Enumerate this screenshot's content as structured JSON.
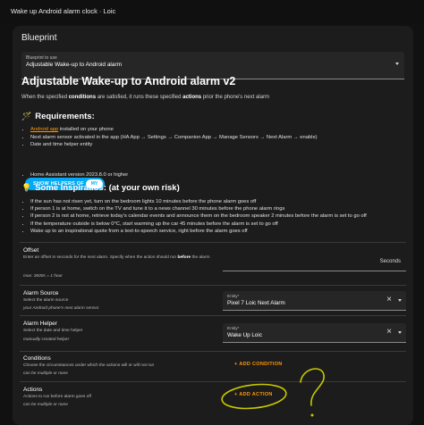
{
  "window": {
    "title": "Wake up Android alarm clock · Loic"
  },
  "card": {
    "title": "Blueprint"
  },
  "blueprint_select": {
    "label": "Blueprint to use",
    "value": "Adjustable Wake-up to Android alarm"
  },
  "blueprint": {
    "title": "Adjustable Wake-up to Android alarm v2",
    "desc_prefix": "When the specified ",
    "desc_conditions": "conditions",
    "desc_middle": " are satisfied, it runs these specified ",
    "desc_actions": "actions",
    "desc_suffix": " prior the phone's next alarm",
    "requirements_icon": "🪄",
    "requirements_heading": "Requirements:",
    "req_link": "Android app",
    "req_1_suffix": " installed on your phone",
    "req_2": "Next alarm sensor activated in the app (HA App → Settings → Companion App → Manage Sensors → Next Alarm → enable)",
    "req_3": "Date and time helper entity",
    "show_helpers_label": "SHOW HELPERS OF",
    "show_helpers_badge": "MY",
    "req_4": "Home Assistant version 2023.8.0 or higher",
    "inspiration_icon": "💡",
    "inspiration_heading": "Some Inspiratios: (at your own risk)",
    "inspirations": [
      "If the sun has not risen yet, turn on the bedroom lights 10 minutes before the phone alarm goes off",
      "If person 1 is at home, switch on the TV and tune it to a news channel 30 minutes before the phone alarm rings",
      "If person 2 is not at home, retrieve today's calendar events and announce them on the bedroom speaker 2 minutes before the alarm is set to go off",
      "If the temperature outside is below 0°C, start warming up the car 45 minutes before the alarm is set to go off",
      "Wake up to an inspirational quote from a text-to-speech service, right before the alarm goes off"
    ]
  },
  "offset": {
    "title": "Offset",
    "desc_prefix": "Enter an offset in seconds for the next alarm. Specify when the action should run ",
    "desc_bold": "before",
    "desc_suffix": " the alarm",
    "helper": "max: 3600s = 1 hour",
    "unit": "Seconds"
  },
  "alarm_source": {
    "title": "Alarm Source",
    "desc": "Select the alarm source",
    "helper": "your Android phone's next alarm sensor",
    "entity_label": "Entity*",
    "entity_value": "Pixel 7 Loic Next Alarm"
  },
  "alarm_helper": {
    "title": "Alarm Helper",
    "desc": "Select the date and time helper",
    "helper": "manually created helper",
    "entity_label": "Entity*",
    "entity_value": "Wake Up Loic"
  },
  "conditions": {
    "title": "Conditions",
    "desc": "Choose the circumstances under which the actions will or will not run",
    "helper": "can be multiple or none",
    "add_label": "ADD CONDITION"
  },
  "actions": {
    "title": "Actions",
    "desc": "Actions to run before alarm goes off",
    "helper": "can be multiple or none",
    "add_label": "ADD ACTION"
  },
  "icons": {
    "clear": "close-icon",
    "dropdown": "chevron-down-icon",
    "add": "plus-icon"
  },
  "colors": {
    "accent": "#ff9800",
    "pill": "#03a9f4",
    "background": "#111111",
    "card": "#1c1c1c",
    "scribble": "#c8c800"
  }
}
